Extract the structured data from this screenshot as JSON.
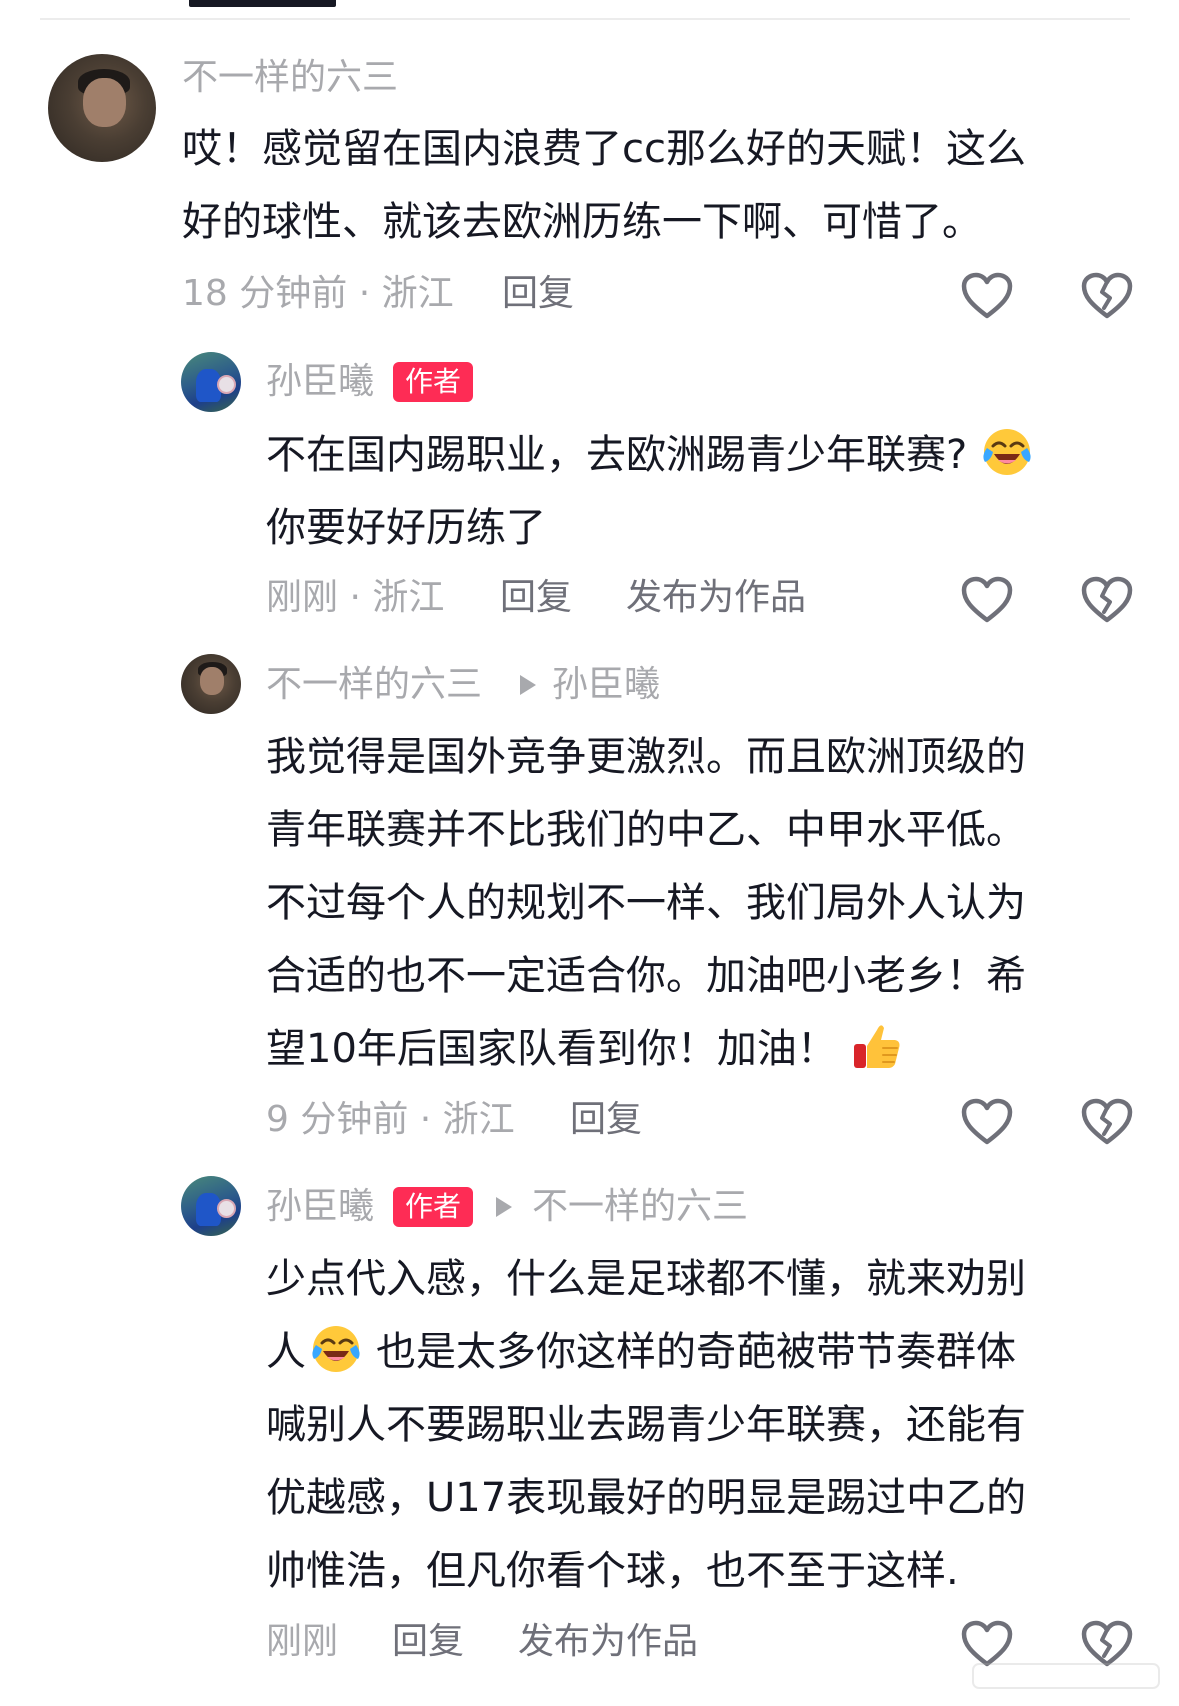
{
  "comments": [
    {
      "username": "不一样的六三",
      "lines": [
        "哎！感觉留在国内浪费了cc那么好的天赋！这么",
        "好的球性、就该去欧洲历练一下啊、可惜了。"
      ],
      "meta": "18 分钟前 · 浙江",
      "reply": "回复"
    },
    {
      "username": "孙臣曦",
      "badge": "作者",
      "lines": [
        "不在国内踢职业，去欧洲踢青少年联赛?",
        "你要好好历练了"
      ],
      "meta": "刚刚 · 浙江",
      "reply": "回复",
      "publish": "发布为作品"
    },
    {
      "username": "不一样的六三",
      "reply_to": "孙臣曦",
      "lines": [
        "我觉得是国外竞争更激烈。而且欧洲顶级的",
        "青年联赛并不比我们的中乙、中甲水平低。",
        "不过每个人的规划不一样、我们局外人认为",
        "合适的也不一定适合你。加油吧小老乡！希",
        "望10年后国家队看到你！加油！"
      ],
      "meta": "9 分钟前 · 浙江",
      "reply": "回复"
    },
    {
      "username": "孙臣曦",
      "badge": "作者",
      "reply_to": "不一样的六三",
      "lines": [
        "少点代入感，什么是足球都不懂，就来劝别",
        "人",
        "也是太多你这样的奇葩被带节奏群体",
        "喊别人不要踢职业去踢青少年联赛，还能有",
        "优越感，U17表现最好的明显是踢过中乙的",
        "帅惟浩，但凡你看个球，也不至于这样."
      ],
      "meta": "刚刚",
      "reply": "回复",
      "publish": "发布为作品"
    }
  ],
  "icons": {
    "like": "heart-outline-icon",
    "dislike": "broken-heart-icon",
    "laugh": "laughing-crying-emoji",
    "thumbs": "thumbs-up-emoji"
  },
  "colors": {
    "badge": "#fe2c55",
    "text": "#161823",
    "muted": "#a8a9ad",
    "action": "#6f7079"
  }
}
